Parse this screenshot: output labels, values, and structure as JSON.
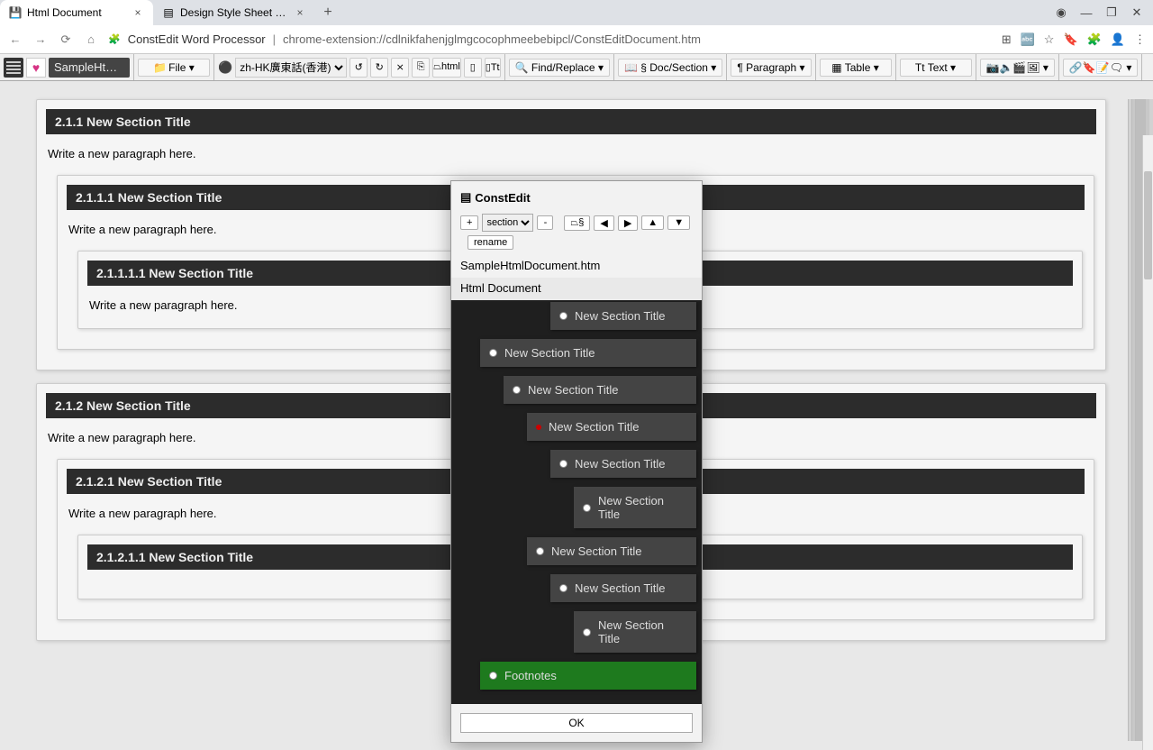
{
  "browser": {
    "tabs": [
      {
        "title": "Html Document",
        "active": true
      },
      {
        "title": "Design Style Sheet For Ht…",
        "active": false
      }
    ],
    "address": {
      "app": "ConstEdit Word Processor",
      "url": "chrome-extension://cdlnikfahenjglmgcocophmeebebipcl/ConstEditDocument.htm"
    }
  },
  "toolbar": {
    "doc_name": "SampleHtmlDocu…",
    "file": "File ▾",
    "lang_select": "zh-HK廣東話(香港)",
    "undo": "↺",
    "redo": "↻",
    "cut": "✂",
    "xsym": "⨯",
    "html_btn": "⏢html",
    "page_btn": "▯",
    "tt_btn": "▯Tt",
    "find": "🔍 Find/Replace ▾",
    "doc_section": "📖 § Doc/Section ▾",
    "paragraph": "¶ Paragraph ▾",
    "table": "▦ Table ▾",
    "text": "Tt Text ▾",
    "media": "📷🔈🎬🖼 ▾",
    "link_icons": "🔗🔖📝🗨 ▾"
  },
  "document": {
    "sections": [
      {
        "num": "2.1.1",
        "title": "New Section Title",
        "para": "Write a new paragraph here.",
        "child": {
          "num": "2.1.1.1",
          "title": "New Section Title",
          "para": "Write a new paragraph here.",
          "child": {
            "num": "2.1.1.1.1",
            "title": "New Section Title",
            "para": "Write a new paragraph here."
          }
        }
      },
      {
        "num": "2.1.2",
        "title": "New Section Title",
        "para": "Write a new paragraph here.",
        "child": {
          "num": "2.1.2.1",
          "title": "New Section Title",
          "para": "Write a new paragraph here.",
          "child": {
            "num": "2.1.2.1.1",
            "title": "New Section Title",
            "para": ""
          }
        }
      }
    ]
  },
  "modal": {
    "title": "ConstEdit",
    "controls": {
      "add": "+",
      "type_select": "section",
      "remove": "-",
      "special": "⏢§",
      "prev": "◀",
      "next": "▶",
      "up": "▲",
      "down": "▼",
      "rename": "rename"
    },
    "filename": "SampleHtmlDocument.htm",
    "doc_title": "Html Document",
    "tree": [
      {
        "indent": 4,
        "label": "New Section Title",
        "sel": false
      },
      {
        "indent": 1,
        "label": "New Section Title",
        "sel": false
      },
      {
        "indent": 2,
        "label": "New Section Title",
        "sel": false
      },
      {
        "indent": 3,
        "label": "New Section Title",
        "sel": true
      },
      {
        "indent": 4,
        "label": "New Section Title",
        "sel": false
      },
      {
        "indent": 5,
        "label": "New Section Title",
        "sel": false
      },
      {
        "indent": 3,
        "label": "New Section Title",
        "sel": false
      },
      {
        "indent": 4,
        "label": "New Section Title",
        "sel": false
      },
      {
        "indent": 5,
        "label": "New Section Title",
        "sel": false
      },
      {
        "indent": 1,
        "label": "Footnotes",
        "sel": false,
        "foot": true
      }
    ],
    "ok": "OK"
  }
}
